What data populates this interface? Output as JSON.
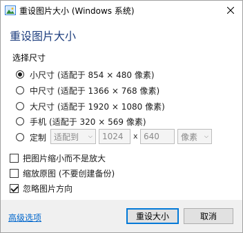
{
  "window": {
    "title": "重设图片大小 (Windows 系统)"
  },
  "heading": "重设图片大小",
  "section_label": "选择尺寸",
  "sizes": [
    {
      "label": "小尺寸",
      "hint": "(适配于 854 × 480 像素)",
      "checked": true
    },
    {
      "label": "中尺寸",
      "hint": "(适配于 1366 × 768 像素)",
      "checked": false
    },
    {
      "label": "大尺寸",
      "hint": "(适配于 1920 × 1080 像素)",
      "checked": false
    },
    {
      "label": "手机",
      "hint": "(适配于 320 × 569 像素)",
      "checked": false
    }
  ],
  "custom": {
    "label": "定制",
    "mode": "适配到",
    "width": "1024",
    "times": "x",
    "height": "640",
    "unit": "像素"
  },
  "options": [
    {
      "label": "把图片缩小而不是放大",
      "checked": false
    },
    {
      "label": "缩放原图 (不要创建备份)",
      "checked": false
    },
    {
      "label": "忽略图片方向",
      "checked": true
    }
  ],
  "footer": {
    "advanced_link": "高级选项",
    "resize_button": "重设大小",
    "cancel_button": "取消"
  },
  "colors": {
    "heading": "#1f3f7f",
    "link": "#0066cc",
    "primary_border": "#0078d7"
  }
}
